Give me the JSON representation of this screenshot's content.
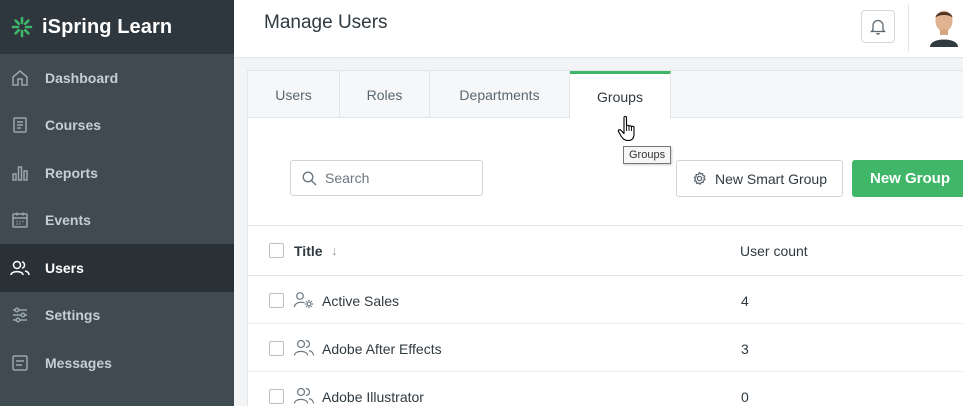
{
  "app": {
    "brand_name": "iSpring Learn",
    "accent_color": "#3fb668",
    "sidebar_color": "#3f4a51"
  },
  "sidebar": {
    "items": [
      {
        "label": "Dashboard",
        "icon": "home-icon",
        "active": false
      },
      {
        "label": "Courses",
        "icon": "courses-icon",
        "active": false
      },
      {
        "label": "Reports",
        "icon": "reports-icon",
        "active": false
      },
      {
        "label": "Events",
        "icon": "calendar-icon",
        "active": false
      },
      {
        "label": "Users",
        "icon": "users-icon",
        "active": true
      },
      {
        "label": "Settings",
        "icon": "settings-icon",
        "active": false
      },
      {
        "label": "Messages",
        "icon": "messages-icon",
        "active": false
      }
    ]
  },
  "header": {
    "title": "Manage Users",
    "notification_icon": "bell-icon",
    "avatar_icon": "user-avatar"
  },
  "tabs": [
    {
      "label": "Users",
      "active": false
    },
    {
      "label": "Roles",
      "active": false
    },
    {
      "label": "Departments",
      "active": false
    },
    {
      "label": "Groups",
      "active": true
    }
  ],
  "tooltip": {
    "text": "Groups"
  },
  "toolbar": {
    "search_placeholder": "Search",
    "smart_group_label": "New Smart Group",
    "new_group_label": "New Group"
  },
  "table": {
    "columns": {
      "title": "Title",
      "title_sort": "↓",
      "user_count": "User count"
    },
    "rows": [
      {
        "title": "Active Sales",
        "user_count": "4",
        "type": "smart-group-icon"
      },
      {
        "title": "Adobe After Effects",
        "user_count": "3",
        "type": "group-icon"
      },
      {
        "title": "Adobe Illustrator",
        "user_count": "0",
        "type": "group-icon"
      }
    ]
  }
}
